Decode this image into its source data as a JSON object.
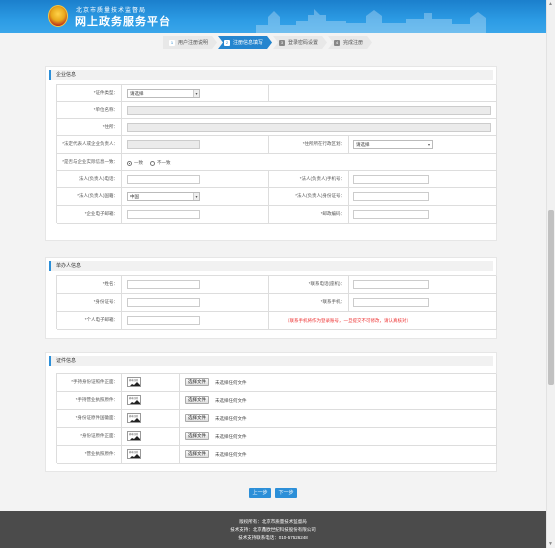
{
  "header": {
    "org": "北京市质量技术监督局",
    "title": "网上政务服务平台"
  },
  "steps": [
    {
      "num": "1",
      "label": "用户注册说明",
      "state": "done"
    },
    {
      "num": "2",
      "label": "注册信息填写",
      "state": "active"
    },
    {
      "num": "3",
      "label": "登录密码设置",
      "state": "inactive"
    },
    {
      "num": "4",
      "label": "完成注册",
      "state": "inactive"
    }
  ],
  "enterprise": {
    "title": "企业信息",
    "cert_type_label": "*证件类型：",
    "cert_type_value": "请选择",
    "unit_name_label": "*单位名称：",
    "address_label": "*住所：",
    "legal_rep_label": "*法定代表人或企业负责人：",
    "district_label": "*住所所在行政区划：",
    "district_value": "请选择",
    "same_as_actual_label": "*是否与企业实际信息一致：",
    "radio_yes": "一致",
    "radio_no": "不一致",
    "phone_label": "法人(负责人)电话：",
    "mobile_label": "*法人(负责人)手机号：",
    "nationality_label": "*法人(负责人)国籍：",
    "nationality_value": "中国",
    "id_label": "*法人(负责人)身份证号：",
    "email_label": "*企业电子邮箱：",
    "postcode_label": "*邮政编码："
  },
  "agent": {
    "title": "单办人信息",
    "name_label": "*姓名：",
    "landline_label": "*联系电话(座机)：",
    "idno_label": "*身份证号：",
    "mobile_label": "*联系手机：",
    "email_label": "*个人电子邮箱：",
    "note": "（联系手机将作为登录账号，一旦提交不可修改，请认真核对）"
  },
  "certs": {
    "title": "证件信息",
    "rows": [
      {
        "label": "*手持身份证照件正面："
      },
      {
        "label": "*手持营业执照原件："
      },
      {
        "label": "*身份证原件国徽面："
      },
      {
        "label": "*身份证原件正面："
      },
      {
        "label": "*营业执照原件："
      }
    ],
    "choose_file": "选择文件",
    "no_file": "未选择任何文件",
    "thumb_caption": "样本示例"
  },
  "buttons": {
    "prev": "上一步",
    "next": "下一步"
  },
  "footer": {
    "line1": "版权所有：北京市质量技术监督局",
    "line2": "技术支持：北京鑫欧世纪科技股份有限公司",
    "line3": "技术支持联系电话：010-57526248"
  },
  "colors": {
    "accent": "#2c8fd8",
    "header": "#1b7fcc",
    "footer": "#4b4b4b",
    "required": "#e33333"
  }
}
